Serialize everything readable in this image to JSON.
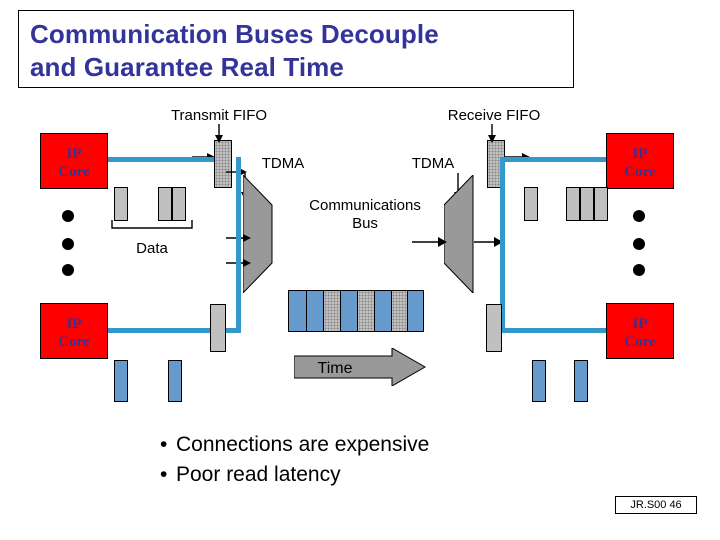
{
  "title": {
    "line1": "Communication Buses Decouple",
    "line2": "and Guarantee Real Time",
    "color": "#333399"
  },
  "labels": {
    "transmit_fifo": "Transmit FIFO",
    "receive_fifo": "Receive FIFO",
    "tdma_left": "TDMA",
    "tdma_right": "TDMA",
    "comm_bus_line1": "Communications",
    "comm_bus_line2": "Bus",
    "data": "Data",
    "time": "Time"
  },
  "ip_cores": [
    {
      "line1": "IP",
      "line2": "Core"
    },
    {
      "line1": "IP",
      "line2": "Core"
    },
    {
      "line1": "IP",
      "line2": "Core"
    },
    {
      "line1": "IP",
      "line2": "Core"
    }
  ],
  "bullets": [
    {
      "marker": "•",
      "text": "Connections are expensive"
    },
    {
      "marker": "•",
      "text": "Poor read latency"
    }
  ],
  "footer": "JR.S00 46",
  "colors": {
    "ip_core_fill": "#ff0000",
    "ip_core_text": "#333399",
    "fifo_blue": "#6699cc",
    "fifo_gray": "#c0c0c0",
    "wire": "#3399cc",
    "arrow_gray": "#999999"
  },
  "bus_bar": {
    "segments": [
      "blue",
      "blue",
      "gray",
      "blue",
      "gray",
      "blue",
      "gray",
      "blue"
    ]
  }
}
